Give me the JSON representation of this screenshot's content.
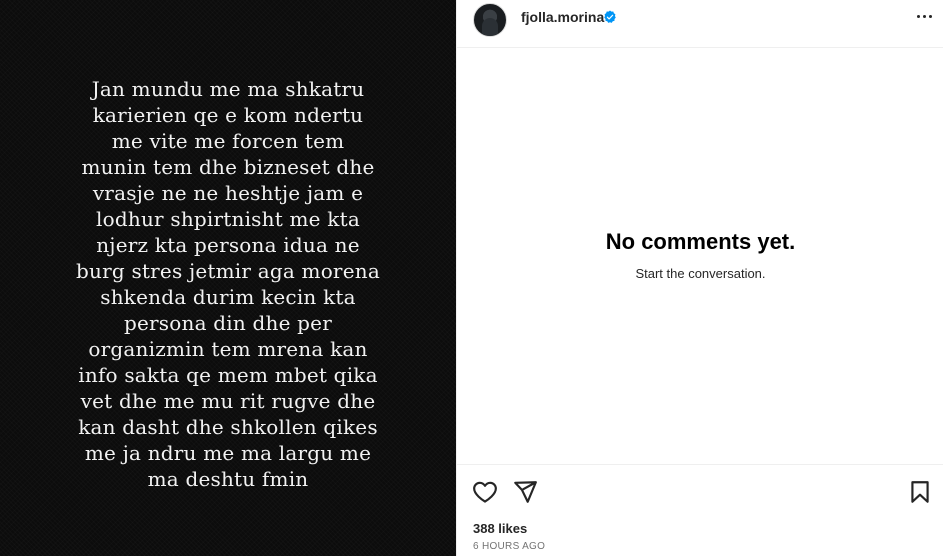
{
  "post": {
    "story_lines": [
      "Jan mundu me ma shkatru",
      "karierien qe e kom ndertu",
      "me vite me forcen tem",
      "munin tem dhe bizneset dhe",
      "vrasje ne ne heshtje jam e",
      "lodhur shpirtnisht me kta",
      "njerz kta persona idua ne",
      "burg stres jetmir aga morena",
      "shkenda durim kecin kta",
      "persona din dhe per",
      "organizmin tem mrena kan",
      "info sakta qe mem mbet qika",
      "vet dhe me mu rit rugve dhe",
      "kan dasht dhe shkollen qikes",
      "me ja ndru me ma largu me",
      "ma deshtu fmin"
    ]
  },
  "header": {
    "username": "fjolla.morina",
    "verified_icon": "verified-badge-icon",
    "more_icon": "more-options-icon"
  },
  "comments": {
    "empty_title": "No comments yet.",
    "empty_subtitle": "Start the conversation."
  },
  "actions": {
    "like_icon": "heart-icon",
    "share_icon": "paper-plane-icon",
    "save_icon": "bookmark-icon",
    "likes_text": "388 likes",
    "time_text": "6 HOURS AGO"
  },
  "colors": {
    "media_background": "#0c0c0c",
    "verified_blue": "#0095f6",
    "border": "#efefef"
  }
}
